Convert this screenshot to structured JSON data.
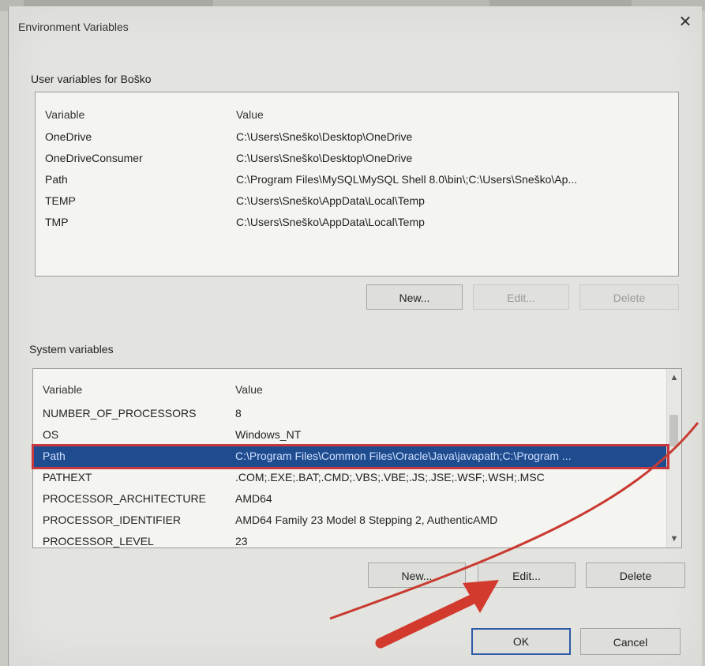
{
  "window": {
    "title": "Environment Variables",
    "close_glyph": "✕"
  },
  "user_vars": {
    "group_label": "User variables for Boško",
    "columns": [
      "Variable",
      "Value"
    ],
    "rows": [
      {
        "name": "OneDrive",
        "value": "C:\\Users\\Sneško\\Desktop\\OneDrive"
      },
      {
        "name": "OneDriveConsumer",
        "value": "C:\\Users\\Sneško\\Desktop\\OneDrive"
      },
      {
        "name": "Path",
        "value": "C:\\Program Files\\MySQL\\MySQL Shell 8.0\\bin\\;C:\\Users\\Sneško\\Ap..."
      },
      {
        "name": "TEMP",
        "value": "C:\\Users\\Sneško\\AppData\\Local\\Temp"
      },
      {
        "name": "TMP",
        "value": "C:\\Users\\Sneško\\AppData\\Local\\Temp"
      }
    ],
    "buttons": {
      "new": "New...",
      "edit": "Edit...",
      "delete": "Delete"
    }
  },
  "system_vars": {
    "group_label": "System variables",
    "columns": [
      "Variable",
      "Value"
    ],
    "selected_index": 2,
    "rows": [
      {
        "name": "NUMBER_OF_PROCESSORS",
        "value": "8"
      },
      {
        "name": "OS",
        "value": "Windows_NT"
      },
      {
        "name": "Path",
        "value": "C:\\Program Files\\Common Files\\Oracle\\Java\\javapath;C:\\Program ..."
      },
      {
        "name": "PATHEXT",
        "value": ".COM;.EXE;.BAT;.CMD;.VBS;.VBE;.JS;.JSE;.WSF;.WSH;.MSC"
      },
      {
        "name": "PROCESSOR_ARCHITECTURE",
        "value": "AMD64"
      },
      {
        "name": "PROCESSOR_IDENTIFIER",
        "value": "AMD64 Family 23 Model 8 Stepping 2, AuthenticAMD"
      },
      {
        "name": "PROCESSOR_LEVEL",
        "value": "23"
      }
    ],
    "buttons": {
      "new": "New...",
      "edit": "Edit...",
      "delete": "Delete"
    }
  },
  "footer": {
    "ok": "OK",
    "cancel": "Cancel"
  },
  "colors": {
    "selection": "#1f4c8f",
    "highlight_outline": "#c8383c",
    "arrow": "#d23a2e"
  },
  "icons": {
    "close": "close-icon",
    "scroll_up": "chevron-up-icon",
    "scroll_down": "chevron-down-icon",
    "annotation": "red-arrow-annotation"
  }
}
